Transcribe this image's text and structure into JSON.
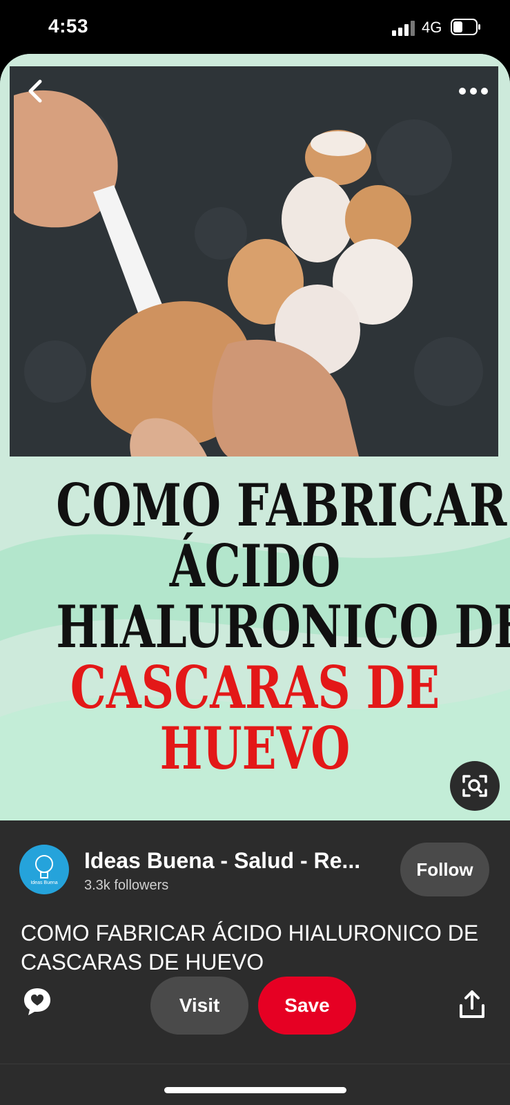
{
  "status_bar": {
    "time": "4:53",
    "network": "4G",
    "icons": [
      "signal-icon",
      "battery-icon"
    ]
  },
  "pin": {
    "image_headline": {
      "dark_lines": [
        "COMO FABRICAR",
        "ÁCIDO",
        "HIALURONICO DE"
      ],
      "red_lines": [
        "CASCARAS DE",
        "HUEVO"
      ]
    },
    "icons": [
      "back-icon",
      "more-options-icon",
      "visual-search-icon"
    ],
    "colors": {
      "headline_dark": "#111111",
      "headline_red": "#e31818",
      "background_mint": "#cdeadb"
    }
  },
  "creator": {
    "name": "Ideas Buena - Salud - Re...",
    "followers": "3.3k followers",
    "avatar_text": "Ideas Buena",
    "follow_label": "Follow"
  },
  "pin_title": "COMO FABRICAR ÁCIDO HIALURONICO DE CASCARAS DE HUEVO",
  "actions": {
    "visit_label": "Visit",
    "save_label": "Save",
    "icons": [
      "comment-icon",
      "share-icon"
    ]
  },
  "colors": {
    "save_button": "#e60023",
    "panel_background": "#2c2c2c",
    "secondary_button": "#4a4a4a"
  }
}
